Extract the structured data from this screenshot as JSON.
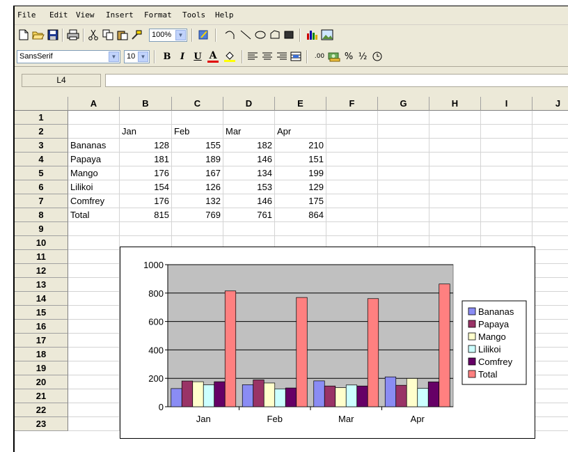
{
  "menubar": [
    "File",
    "Edit",
    "View",
    "Insert",
    "Format",
    "Tools",
    "Help"
  ],
  "toolbar": {
    "zoom": "100%",
    "font_name": "SansSerif",
    "font_size": "10",
    "bold": "B",
    "italic": "I",
    "underline": "U",
    "font_color": "A",
    "number_format": ".00",
    "percent": "%",
    "fraction": "½"
  },
  "name_box": "L4",
  "formula": "",
  "columns": [
    "A",
    "B",
    "C",
    "D",
    "E",
    "F",
    "G",
    "H",
    "I",
    "J"
  ],
  "rows": [
    "1",
    "2",
    "3",
    "4",
    "5",
    "6",
    "7",
    "8",
    "9",
    "10",
    "11",
    "12",
    "13",
    "14",
    "15",
    "16",
    "17",
    "18",
    "19",
    "20",
    "21",
    "22",
    "23"
  ],
  "sheet": {
    "headers": [
      "Jan",
      "Feb",
      "Mar",
      "Apr"
    ],
    "data": [
      {
        "label": "Bananas",
        "values": [
          "128",
          "155",
          "182",
          "210"
        ]
      },
      {
        "label": "Papaya",
        "values": [
          "181",
          "189",
          "146",
          "151"
        ]
      },
      {
        "label": "Mango",
        "values": [
          "176",
          "167",
          "134",
          "199"
        ]
      },
      {
        "label": "Lilikoi",
        "values": [
          "154",
          "126",
          "153",
          "129"
        ]
      },
      {
        "label": "Comfrey",
        "values": [
          "176",
          "132",
          "146",
          "175"
        ]
      },
      {
        "label": "Total",
        "values": [
          "815",
          "769",
          "761",
          "864"
        ]
      }
    ]
  },
  "chart_data": {
    "type": "bar",
    "categories": [
      "Jan",
      "Feb",
      "Mar",
      "Apr"
    ],
    "series": [
      {
        "name": "Bananas",
        "values": [
          128,
          155,
          182,
          210
        ],
        "color": "#8a8cf4"
      },
      {
        "name": "Papaya",
        "values": [
          181,
          189,
          146,
          151
        ],
        "color": "#993366"
      },
      {
        "name": "Mango",
        "values": [
          176,
          167,
          134,
          199
        ],
        "color": "#ffffcc"
      },
      {
        "name": "Lilikoi",
        "values": [
          154,
          126,
          153,
          129
        ],
        "color": "#ccffff"
      },
      {
        "name": "Comfrey",
        "values": [
          176,
          132,
          146,
          175
        ],
        "color": "#660066"
      },
      {
        "name": "Total",
        "values": [
          815,
          769,
          761,
          864
        ],
        "color": "#ff8080"
      }
    ],
    "yticks": [
      "0",
      "200",
      "400",
      "600",
      "800",
      "1000"
    ],
    "ylim": [
      0,
      1000
    ],
    "plot_background": "#c0c0c0",
    "grid": true,
    "legend": "right"
  }
}
